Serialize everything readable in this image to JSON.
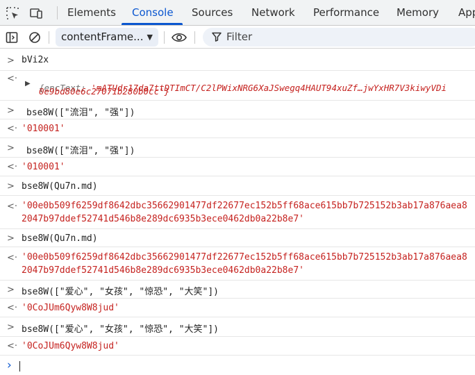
{
  "tabs": [
    "Elements",
    "Console",
    "Sources",
    "Network",
    "Performance",
    "Memory",
    "App"
  ],
  "active_tab": "Console",
  "toolbar": {
    "context": "contentFrame...",
    "filter_placeholder": "Filter"
  },
  "console": {
    "r1_cmd": "bVi2x",
    "r2_obj_key": "{encText: ",
    "r2_obj_val1": "'mATUdr17da7ttDTImCT/C2lPWixNRG6XaJSwegq4HAUT94xuZf…jwYxHR7V3kiwyVDi",
    "r2_obj_val2": "0e9bd80e6c27071b280b0cc'}",
    "r3_cmd": "bse8W([\"流泪\", \"强\"])",
    "r4_out": "'010001'",
    "r5_cmd": "bse8W([\"流泪\", \"强\"])",
    "r6_out": "'010001'",
    "r7_cmd": "bse8W(Qu7n.md)",
    "r8_out1": "'00e0b509f6259df8642dbc35662901477df22677ec152b5ff68ace615bb7b725152b3ab17a876aea8",
    "r8_out2": "2047b97ddef52741d546b8e289dc6935b3ece0462db0a22b8e7'",
    "r9_cmd": "bse8W(Qu7n.md)",
    "r10_out1": "'00e0b509f6259df8642dbc35662901477df22677ec152b5ff68ace615bb7b725152b3ab17a876aea8",
    "r10_out2": "2047b97ddef52741d546b8e289dc6935b3ece0462db0a22b8e7'",
    "r11_cmd": "bse8W([\"爱心\", \"女孩\", \"惊恐\", \"大笑\"])",
    "r12_out": "'0CoJUm6Qyw8W8jud'",
    "r13_cmd": "bse8W([\"爱心\", \"女孩\", \"惊恐\", \"大笑\"])",
    "r14_out": "'0CoJUm6Qyw8W8jud'",
    "input_marker": "›",
    "input_marker_color": "#0b57d0",
    "string_color": "#c5221f",
    "accent_color": "#0b57d0"
  }
}
